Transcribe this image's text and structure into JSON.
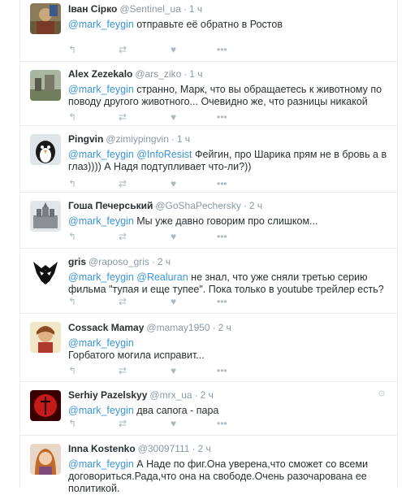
{
  "tweets": [
    {
      "name": "Іван Сірко",
      "handle": "@Sentinel_ua",
      "time": "1 ч",
      "segments": [
        {
          "t": "@mark_feygin",
          "m": true
        },
        {
          "t": " отправьте её обратно в Ростов",
          "m": false
        }
      ]
    },
    {
      "name": "Alex Zezekalo",
      "handle": "@ars_ziko",
      "time": "1 ч",
      "segments": [
        {
          "t": "@mark_feygin",
          "m": true
        },
        {
          "t": " странно,  Марк,  что вы обращаетесь к животному по поводу другого животного... Очевидно же,  что разницы никакой",
          "m": false
        }
      ]
    },
    {
      "name": "Pingvin",
      "handle": "@zimiypingvin",
      "time": "1 ч",
      "segments": [
        {
          "t": "@mark_feygin",
          "m": true
        },
        {
          "t": " ",
          "m": false
        },
        {
          "t": "@InfoResist",
          "m": true
        },
        {
          "t": " Фейгин, про Шарика прям не в бровь а в глаз)))) А Надя подтупливает что-ли?))",
          "m": false
        }
      ]
    },
    {
      "name": "Гоша Печерський",
      "handle": "@GoShaPechersky",
      "time": "2 ч",
      "segments": [
        {
          "t": "@mark_feygin",
          "m": true
        },
        {
          "t": " Мы уже давно говорим про слишком...",
          "m": false
        }
      ]
    },
    {
      "name": "gris",
      "handle": "@raposo_gris",
      "time": "2 ч",
      "segments": [
        {
          "t": "@mark_feygin",
          "m": true
        },
        {
          "t": " ",
          "m": false
        },
        {
          "t": "@Realuran",
          "m": true
        },
        {
          "t": " не знал, что уже сняли третью серию фильма \"тупая и еще тупее\". Пока только в youtube трейлер есть?",
          "m": false
        }
      ]
    },
    {
      "name": "Cossack Mamay",
      "handle": "@mamay1950",
      "time": "2 ч",
      "segments": [
        {
          "t": "@mark_feygin",
          "m": true
        },
        {
          "t": "\nГорбатого могила исправит...",
          "m": false
        }
      ]
    },
    {
      "name": "Serhiy Pazelskyy",
      "handle": "@mrx_ua",
      "time": "2 ч",
      "segments": [
        {
          "t": "@mark_feygin",
          "m": true
        },
        {
          "t": " два сапога - пара",
          "m": false
        }
      ]
    },
    {
      "name": "Inna Kostenko",
      "handle": "@30097111",
      "time": "2 ч",
      "segments": [
        {
          "t": "@mark_feygin",
          "m": true
        },
        {
          "t": " А Наде по фиг.Она уверена,что сможет со всеми договориться.Рада,что она на свободе.Очень разочарована ее политикой.",
          "m": false
        }
      ]
    }
  ],
  "separator": "·",
  "action_icons": [
    "reply-icon",
    "retweet-icon",
    "like-icon",
    "more-icon"
  ],
  "colors": {
    "mention": "#3b94d9",
    "muted": "#8899a6",
    "icon": "#aab8c2",
    "border": "#e6ecf0"
  }
}
